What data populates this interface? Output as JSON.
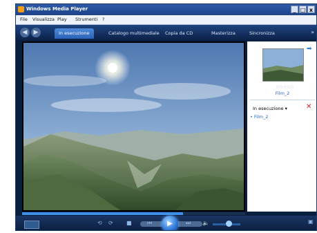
{
  "window": {
    "title": "Windows Media Player"
  },
  "window_buttons": {
    "minimize": "_",
    "maximize": "□",
    "close": "x"
  },
  "menu": [
    "File",
    "Visualizza",
    "Play",
    "Strumenti",
    "?"
  ],
  "tabs": [
    {
      "label": "In esecuzione",
      "active": true
    },
    {
      "label": "Catalogo multimediale"
    },
    {
      "label": "Copia da CD"
    },
    {
      "label": "Masterizza"
    },
    {
      "label": "Sincronizza"
    }
  ],
  "now_playing": {
    "title": "Film_2",
    "rating_stars": "☆☆☆☆☆",
    "list_label": "In esecuzione",
    "dropdown_glyph": "▾",
    "playlist": [
      "• Film_2"
    ]
  },
  "playback": {
    "progress": 0.72
  },
  "colors": {
    "accent": "#2a64c4",
    "delete": "#d62020",
    "chrome": "#0c2148"
  }
}
